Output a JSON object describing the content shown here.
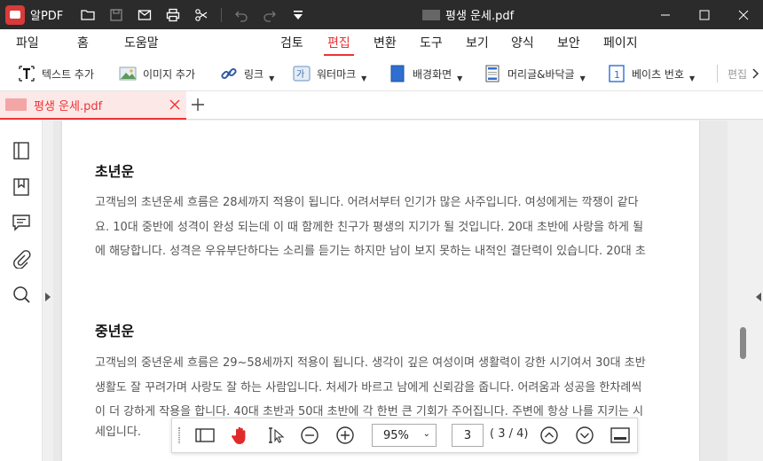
{
  "titlebar": {
    "app_name": "알PDF",
    "document_title": "평생 운세.pdf"
  },
  "menu": {
    "left": [
      "파일",
      "홈",
      "도움말"
    ],
    "center": [
      "검토",
      "편집",
      "변환",
      "도구",
      "보기",
      "양식",
      "보안",
      "페이지"
    ],
    "active": "편집"
  },
  "toolbar": {
    "add_text": "텍스트 추가",
    "add_image": "이미지 추가",
    "link": "링크",
    "watermark": "워터마크",
    "background": "배경화면",
    "header_footer": "머리글&바닥글",
    "bates": "베이츠 번호",
    "edit": "편집"
  },
  "tab": {
    "label": "평생 운세.pdf"
  },
  "document": {
    "sections": [
      {
        "title": "초년운",
        "lines": [
          "고객님의 초년운세 흐름은 28세까지 적용이 됩니다. 어려서부터 인기가 많은 사주입니다. 여성에게는 깍쟁이 같다",
          "요. 10대 중반에 성격이 완성 되는데 이 때 함께한 친구가 평생의 지기가 될 것입니다. 20대 초반에 사랑을 하게 될",
          "에 해당합니다. 성격은 우유부단하다는 소리를 듣기는 하지만 남이 보지 못하는 내적인 결단력이 있습니다. 20대 초"
        ]
      },
      {
        "title": "중년운",
        "lines": [
          "고객님의 중년운세 흐름은 29~58세까지 적용이 됩니다. 생각이 깊은 여성이며 생활력이 강한 시기여서 30대 초반",
          "생활도 잘 꾸려가며 사랑도 잘 하는 사람입니다. 처세가 바르고 남에게 신뢰감을 줍니다. 어려움과 성공을 한차례씩",
          "이 더 강하게 작용을 합니다. 40대 초반과 50대 초반에 각 한번 큰 기회가 주어집니다. 주변에 항상 나를 지키는 시",
          "세입니다."
        ]
      }
    ]
  },
  "floatbar": {
    "zoom": "95%",
    "current_page": "3",
    "page_total": "( 3 / 4)"
  },
  "colors": {
    "accent": "#e33333",
    "titlebar": "#2b2b2b"
  }
}
